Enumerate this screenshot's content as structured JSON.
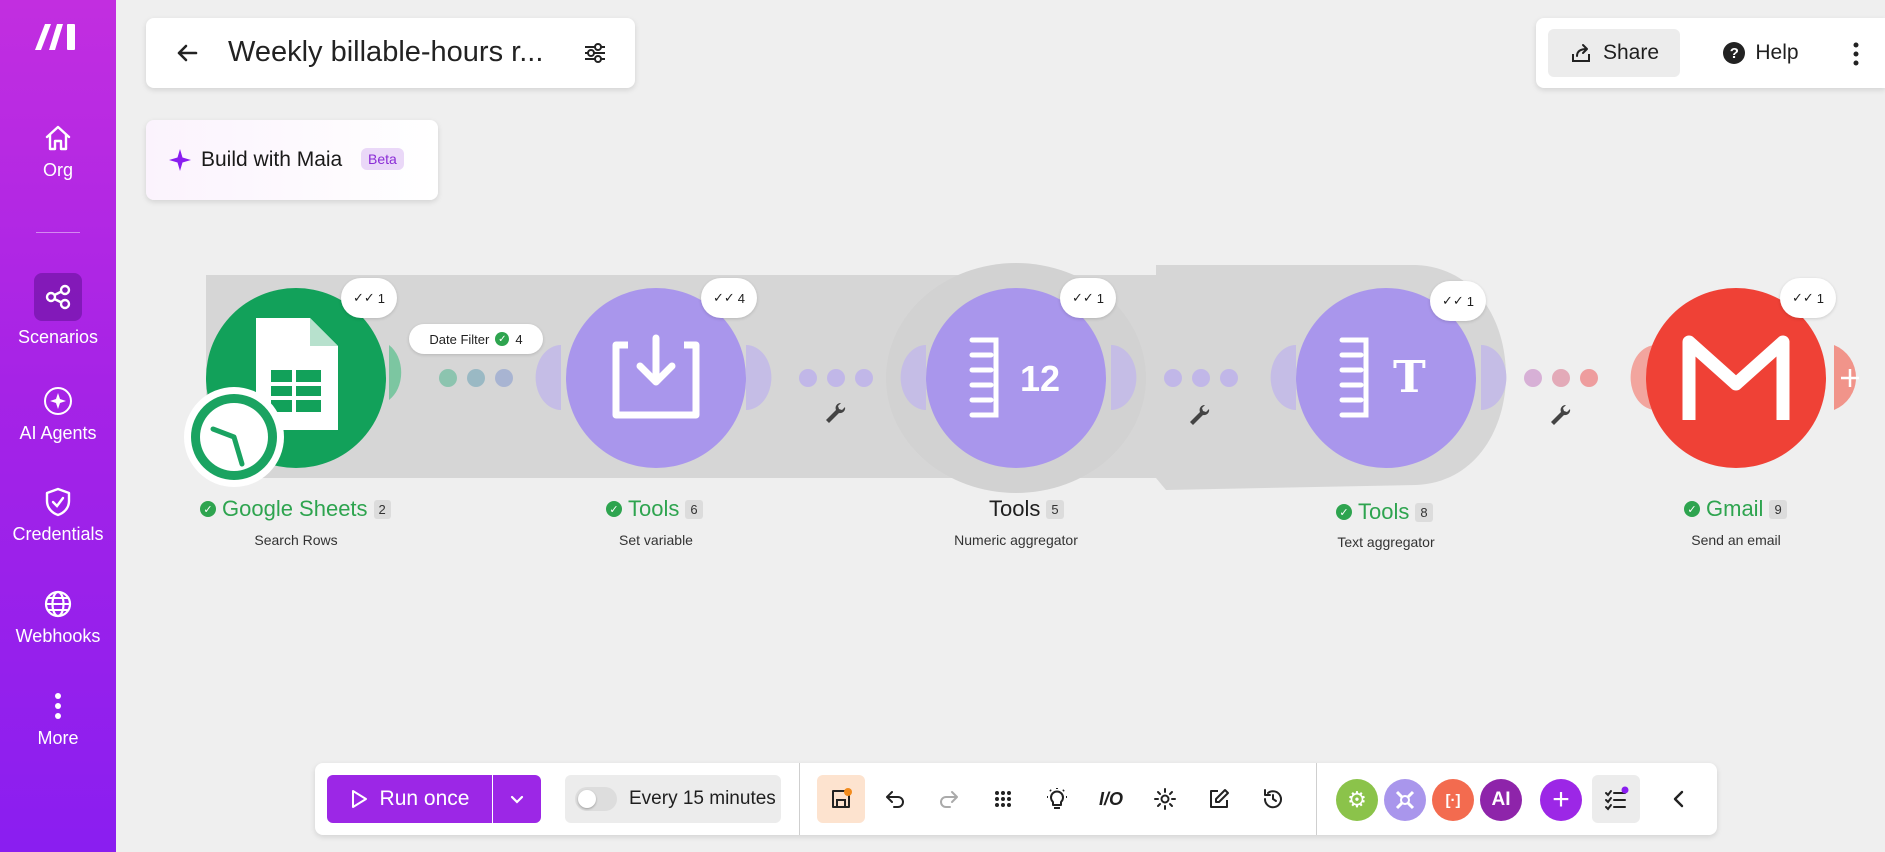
{
  "sidebar": {
    "items": [
      {
        "label": "Org",
        "icon": "home-icon"
      },
      {
        "label": "Scenarios",
        "icon": "share-nodes-icon"
      },
      {
        "label": "AI Agents",
        "icon": "sparkle-icon"
      },
      {
        "label": "Credentials",
        "icon": "shield-check-icon"
      },
      {
        "label": "Webhooks",
        "icon": "globe-icon"
      },
      {
        "label": "More",
        "icon": "dots-vertical-icon"
      }
    ]
  },
  "header": {
    "title": "Weekly billable-hours r..."
  },
  "maia": {
    "label": "Build with Maia",
    "badge": "Beta"
  },
  "top_actions": {
    "share": "Share",
    "help": "Help"
  },
  "scenario": {
    "modules": [
      {
        "name": "Google Sheets",
        "id": "2",
        "subtitle": "Search Rows",
        "ops": "1",
        "color": "#12a15a"
      },
      {
        "name": "Tools",
        "id": "6",
        "subtitle": "Set variable",
        "ops": "4",
        "color": "#a996ec"
      },
      {
        "name": "Tools",
        "id": "5",
        "subtitle": "Numeric aggregator",
        "ops": "1",
        "color": "#a996ec"
      },
      {
        "name": "Tools",
        "id": "8",
        "subtitle": "Text aggregator",
        "ops": "1",
        "color": "#a996ec"
      },
      {
        "name": "Gmail",
        "id": "9",
        "subtitle": "Send an email",
        "ops": "1",
        "color": "#ef4136"
      }
    ],
    "filter": {
      "label": "Date Filter",
      "count": "4"
    },
    "aggregator_text": "12",
    "aggregator_letter": "T"
  },
  "toolbar": {
    "run_label": "Run once",
    "schedule_label": "Every 15 minutes",
    "io_label": "I/O",
    "ai_label": "AI",
    "bracket_label": "[·]"
  },
  "colors": {
    "accent": "#9c27e6",
    "sheets": "#12a15a",
    "tools": "#a996ec",
    "gmail": "#ef4136",
    "ok": "#2ea44f"
  }
}
